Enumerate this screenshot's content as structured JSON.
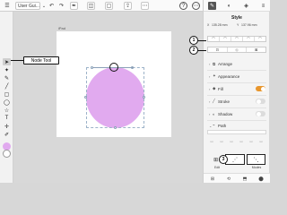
{
  "topbar": {
    "doc_name": "User Gui...",
    "chevron": "⌄",
    "undo": "↶",
    "redo": "↷",
    "vector": "✒",
    "boolean": "◫",
    "frame": "▢",
    "share": "⇪",
    "more": "⋯",
    "help": "?",
    "options": "⋯"
  },
  "tools": {
    "move": "➤",
    "node": "✦",
    "pen": "✎",
    "pencil": "╱",
    "rect": "▢",
    "ellipse": "◯",
    "star": "☆",
    "text": "T",
    "transform": "✛",
    "eyedropper": "✐",
    "fill_color": "#e1aaef",
    "stroke_color": "#ffffff"
  },
  "canvas": {
    "artboard_label": "iPad"
  },
  "callouts": {
    "node_tool": "Node Tool",
    "one": "1",
    "two": "2",
    "three": "3"
  },
  "panel": {
    "tabs": [
      "✎",
      "◐",
      "◈",
      "≡"
    ],
    "title": "Style",
    "x_label": "X",
    "x_value": "135.28 mm",
    "y_label": "Y",
    "y_value": "137.96 mm",
    "node_type_buttons": [
      "⌒",
      "⌒",
      "⌒",
      "⌒",
      "⌒"
    ],
    "action_buttons": [
      "⊡",
      "◇",
      "⊠"
    ],
    "sections": [
      {
        "label": "Arrange",
        "icon": "⧉"
      },
      {
        "label": "Appearance",
        "icon": "✦"
      },
      {
        "label": "Fill",
        "icon": "◆"
      },
      {
        "label": "Stroke",
        "icon": "╱"
      },
      {
        "label": "Shadow",
        "icon": "◐"
      },
      {
        "label": "Path",
        "icon": "⌁"
      }
    ],
    "fill_on": true,
    "stroke_on": false,
    "shadow_on": false,
    "path_small": [
      "▭",
      "▭",
      "▭",
      "▭",
      "▭",
      "▭"
    ],
    "bottom_buttons": [
      "⊞",
      "⋰",
      "⋱"
    ],
    "bottom_labels": [
      "Edit",
      "",
      "Modes"
    ],
    "footer": [
      "⊞",
      "⟲",
      "⬒",
      "⬤"
    ]
  },
  "colors": {
    "accent": "#e8962d",
    "shape_fill": "#e1aaef"
  }
}
